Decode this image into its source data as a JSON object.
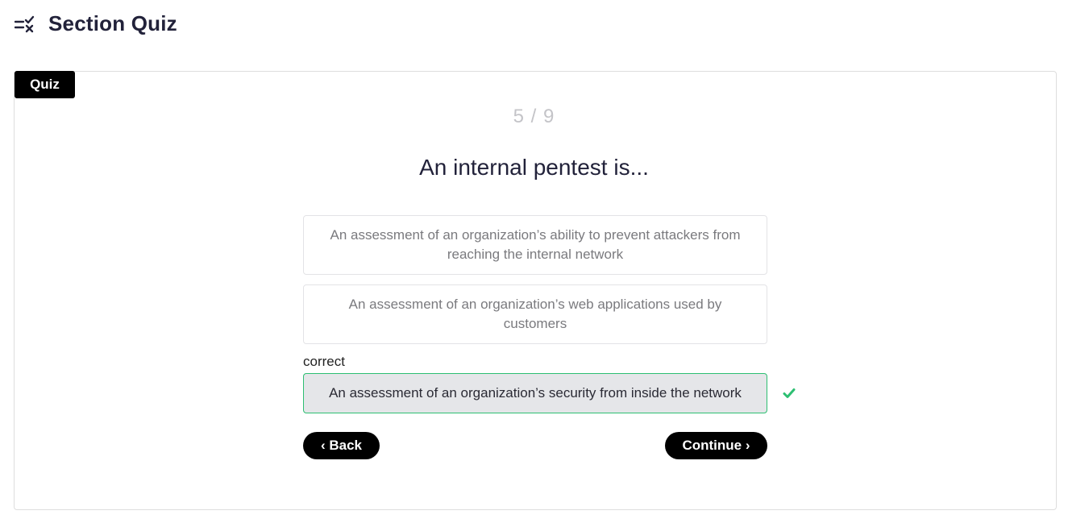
{
  "header": {
    "icon": "checklist-icon",
    "title": "Section Quiz"
  },
  "quiz": {
    "tag_label": "Quiz",
    "progress": "5 / 9",
    "question": "An internal pentest is...",
    "answers": [
      {
        "text": "An assessment of an organization’s ability to prevent attackers from reaching the internal network"
      },
      {
        "text": "An assessment of an organization’s web applications used by customers"
      },
      {
        "text": "An assessment of an organization’s security from inside the network"
      }
    ],
    "correct_label": "correct",
    "back_label": "‹ Back",
    "continue_label": "Continue ›"
  },
  "colors": {
    "accent": "#000000",
    "correct_border": "#2dbf72",
    "check": "#2dbf72",
    "selected_bg": "#e5e6e9"
  }
}
